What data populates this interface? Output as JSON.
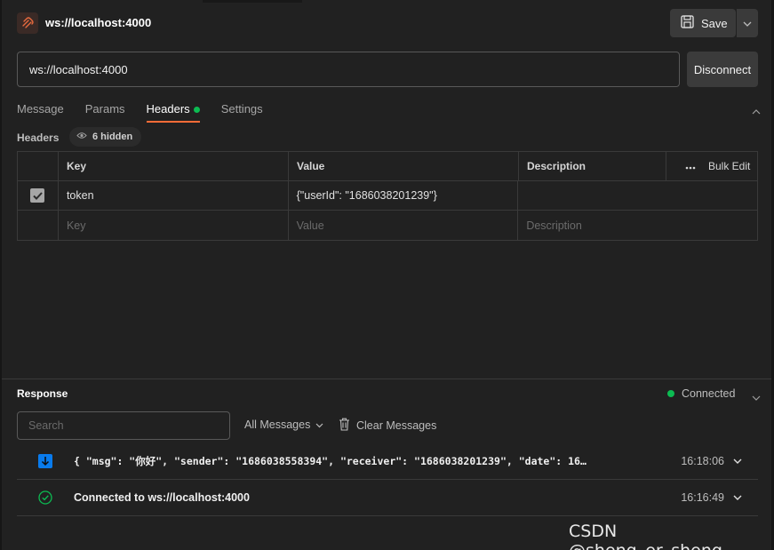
{
  "header": {
    "title": "ws://localhost:4000",
    "save_label": "Save"
  },
  "url_bar": {
    "value": "ws://localhost:4000",
    "disconnect_label": "Disconnect"
  },
  "tabs": [
    {
      "label": "Message"
    },
    {
      "label": "Params"
    },
    {
      "label": "Headers"
    },
    {
      "label": "Settings"
    }
  ],
  "headers_section": {
    "title": "Headers",
    "hidden_label": "6 hidden",
    "columns": {
      "key": "Key",
      "value": "Value",
      "description": "Description",
      "bulk_edit": "Bulk Edit"
    },
    "rows": [
      {
        "key": "token",
        "value": "{\"userId\": \"1686038201239\"}",
        "description": "",
        "checked": true
      }
    ],
    "placeholders": {
      "key": "Key",
      "value": "Value",
      "description": "Description"
    }
  },
  "response": {
    "title": "Response",
    "status": "Connected",
    "search_placeholder": "Search",
    "filter_label": "All Messages",
    "clear_label": "Clear Messages",
    "messages": [
      {
        "text": "{ \"msg\": \"你好\", \"sender\": \"1686038558394\", \"receiver\": \"1686038201239\", \"date\": 16…",
        "time": "16:18:06",
        "icon": "incoming-arrow-icon"
      },
      {
        "text": "Connected to ws://localhost:4000",
        "time": "16:16:49",
        "icon": "check-circle-icon"
      }
    ]
  },
  "watermark": "CSDN @sheng_er_sheng",
  "colors": {
    "background": "#212121",
    "accent": "#ff6c37",
    "status_green": "#0cbb52",
    "incoming_blue": "#097bed"
  }
}
